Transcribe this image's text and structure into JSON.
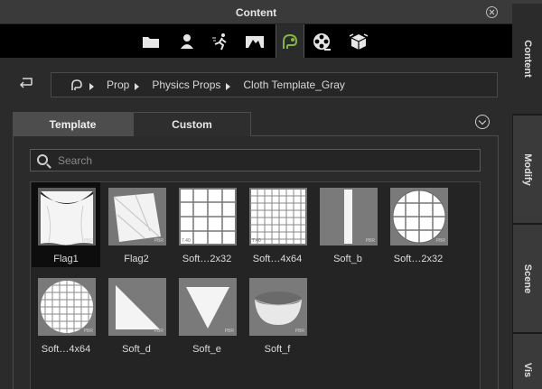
{
  "window": {
    "title": "Content"
  },
  "toolbar": {
    "icons": [
      "folder-icon",
      "avatar-icon",
      "motion-icon",
      "stage-icon",
      "prop-icon",
      "film-reel-icon",
      "package-icon"
    ],
    "active": "prop-icon"
  },
  "side_tabs": [
    "Content",
    "Modify",
    "Scene",
    "Vis"
  ],
  "breadcrumb": [
    "Prop",
    "Physics Props",
    "Cloth Template_Gray"
  ],
  "tabs": {
    "template": "Template",
    "custom": "Custom"
  },
  "search": {
    "placeholder": "Search"
  },
  "items": [
    {
      "label": "Flag1",
      "thumb": "flag1",
      "selected": true
    },
    {
      "label": "Flag2",
      "thumb": "flag2",
      "selected": false
    },
    {
      "label": "Soft…2x32",
      "thumb": "grid4",
      "selected": false
    },
    {
      "label": "Soft…4x64",
      "thumb": "grid8",
      "selected": false
    },
    {
      "label": "Soft_b",
      "thumb": "strip",
      "selected": false
    },
    {
      "label": "Soft…2x32",
      "thumb": "circle4",
      "selected": false
    },
    {
      "label": "Soft…4x64",
      "thumb": "circle8",
      "selected": false
    },
    {
      "label": "Soft_d",
      "thumb": "triangle-left",
      "selected": false
    },
    {
      "label": "Soft_e",
      "thumb": "triangle-down",
      "selected": false
    },
    {
      "label": "Soft_f",
      "thumb": "bowl",
      "selected": false
    }
  ],
  "thumb_badges": {
    "pbr": "PBR",
    "size_a": "7.40",
    "size_b": "7.40"
  },
  "colors": {
    "accent": "#7fb93a",
    "panel": "#2b2b2b",
    "toolbar": "#000000"
  }
}
